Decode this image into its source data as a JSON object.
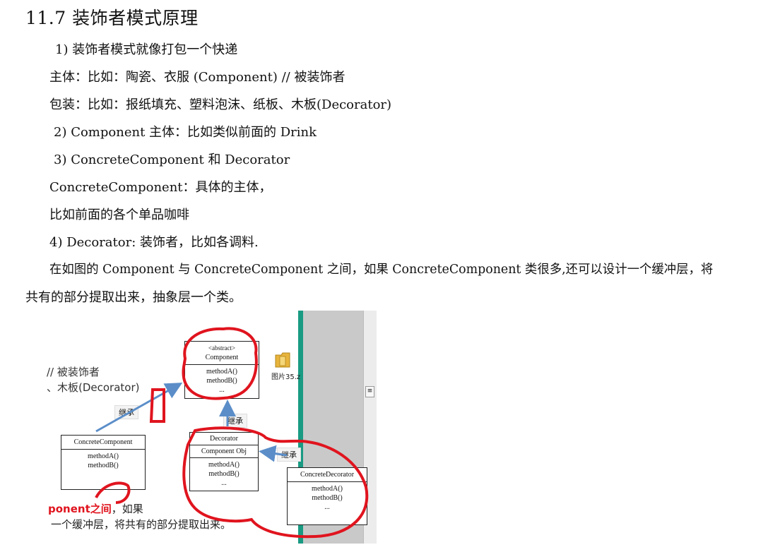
{
  "heading": "11.7  装饰者模式原理",
  "lines": {
    "l1": "1)  装饰者模式就像打包一个快递",
    "l2": "主体：比如：陶瓷、衣服  (Component) //  被装饰者",
    "l3": "包装：比如：报纸填充、塑料泡沫、纸板、木板(Decorator)",
    "l4": "2)  Component 主体：比如类似前面的 Drink",
    "l5": "3)  ConcreteComponent 和 Decorator",
    "l6": "ConcreteComponent：具体的主体，",
    "l7": "比如前面的各个单品咖啡",
    "l8": "4) Decorator:  装饰者，比如各调料.",
    "l9": "在如图的 Component 与 ConcreteComponent 之间，如果 ConcreteComponent 类很多,还可以设计一个缓冲层，将",
    "l10": "共有的部分提取出来，抽象层一个类。"
  },
  "figure": {
    "bg_text_1": "// 被装饰者",
    "bg_text_2": "、木板(Decorator)",
    "bg_text_3_red": "ponent之间",
    "bg_text_3_rest": "，如果",
    "bg_text_4": "一个缓冲层，将共有的部分提取出来。",
    "file_label": "图片35.z",
    "inherit_label": "继承",
    "component": {
      "stereotype": "<abstract>",
      "name": "Component",
      "m1": "methodA()",
      "m2": "methodB()",
      "m3": "..."
    },
    "concrete_component": {
      "name": "ConcreteComponent",
      "m1": "methodA()",
      "m2": "methodB()"
    },
    "decorator": {
      "name": "Decorator",
      "field": "Component Obj",
      "m1": "methodA()",
      "m2": "methodB()",
      "m3": "..."
    },
    "concrete_decorator": {
      "name": "ConcreteDecorator",
      "m1": "methodA()",
      "m2": "methodB()",
      "m3": "..."
    },
    "scroll_glyph": "≡"
  },
  "colors": {
    "annotation_red": "#e0141e",
    "arrow_blue": "#5b8ec9",
    "panel_green": "#199a83",
    "panel_gray": "#c9c9c9"
  }
}
